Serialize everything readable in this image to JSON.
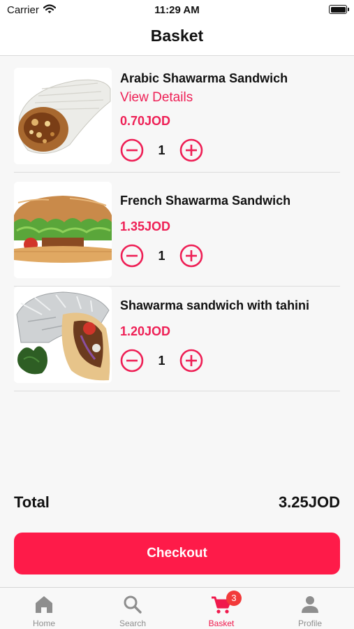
{
  "status_bar": {
    "carrier": "Carrier",
    "time": "11:29 AM"
  },
  "header": {
    "title": "Basket"
  },
  "basket": {
    "items": [
      {
        "name": "Arabic Shawarma Sandwich",
        "link": "View Details",
        "price": "0.70JOD",
        "quantity": "1"
      },
      {
        "name": "French Shawarma Sandwich",
        "price": "1.35JOD",
        "quantity": "1"
      },
      {
        "name": "Shawarma sandwich with tahini",
        "price": "1.20JOD",
        "quantity": "1"
      }
    ]
  },
  "summary": {
    "total_label": "Total",
    "total_value": "3.25JOD"
  },
  "actions": {
    "checkout_label": "Checkout"
  },
  "tab_bar": {
    "tabs": [
      {
        "label": "Home",
        "icon": "home-icon"
      },
      {
        "label": "Search",
        "icon": "search-icon"
      },
      {
        "label": "Basket",
        "icon": "cart-icon",
        "badge": "3",
        "active": true
      },
      {
        "label": "Profile",
        "icon": "person-icon"
      }
    ]
  },
  "colors": {
    "accent": "#ee1f55",
    "checkout": "#fe1b49",
    "badge": "#f23a3a"
  }
}
